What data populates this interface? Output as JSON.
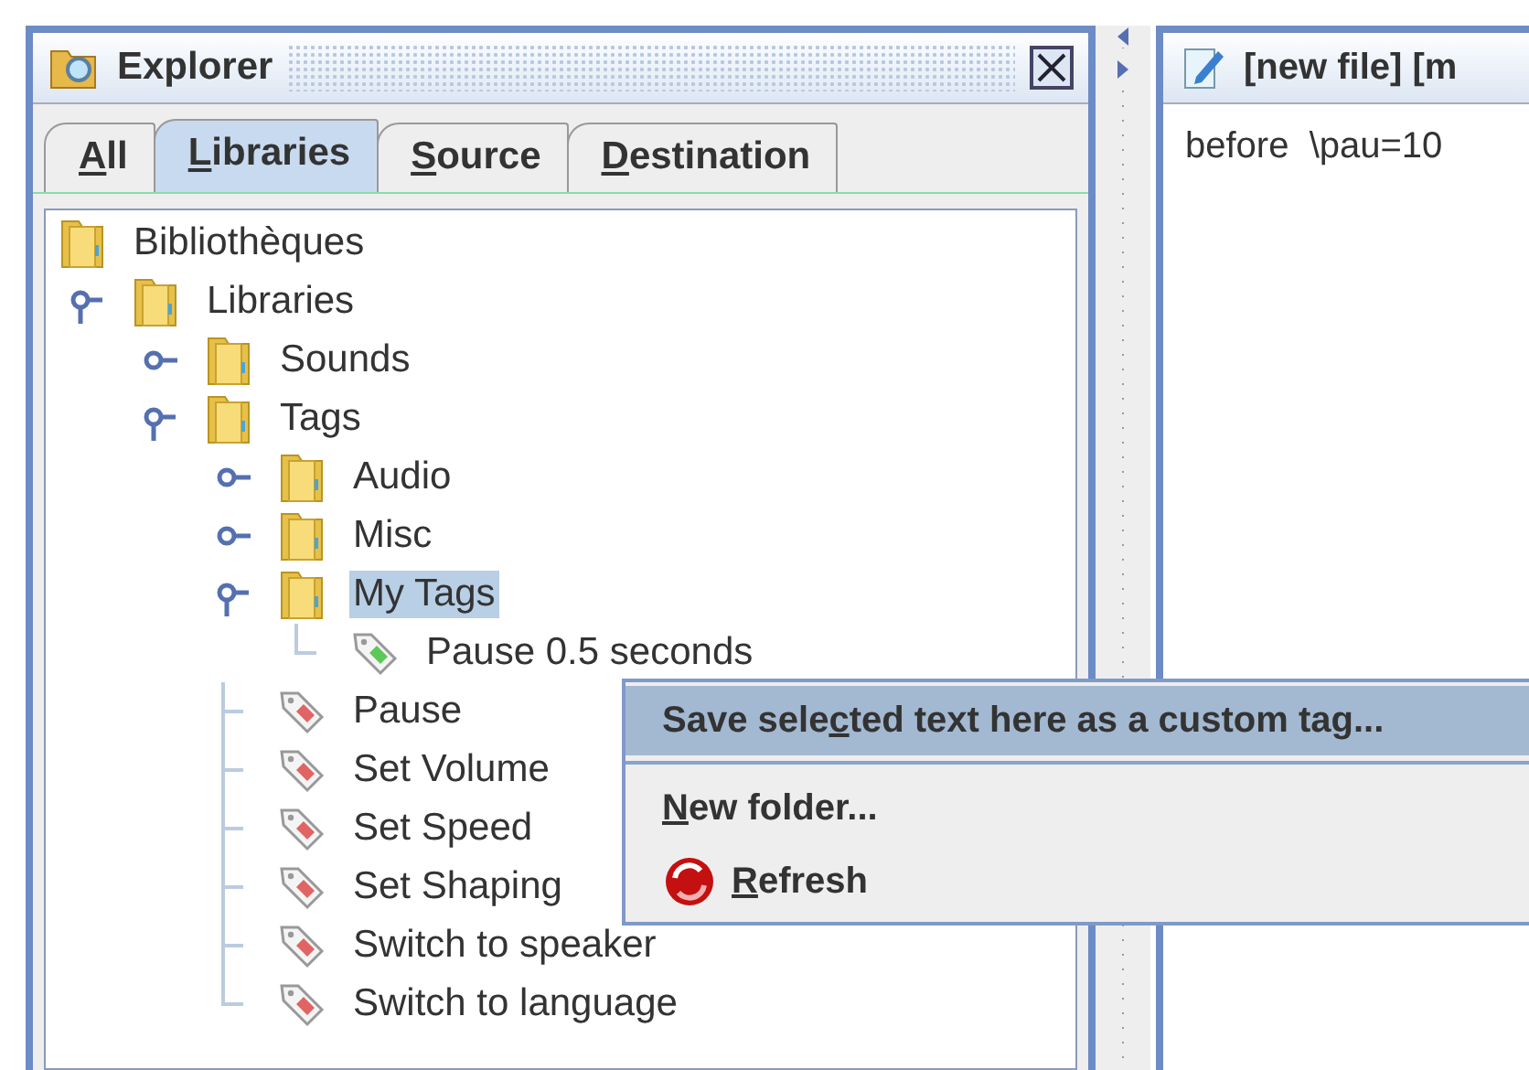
{
  "explorer": {
    "title": "Explorer",
    "tabs": [
      {
        "label_parts": {
          "key": "A",
          "after": "ll"
        },
        "selected": false
      },
      {
        "label_parts": {
          "key": "L",
          "after": "ibraries"
        },
        "selected": true
      },
      {
        "label_parts": {
          "key": "S",
          "after": "ource"
        },
        "selected": false
      },
      {
        "label_parts": {
          "key": "D",
          "after": "estination"
        },
        "selected": false
      }
    ],
    "tree": [
      {
        "kind": "folder",
        "label": "Bibliothèques",
        "selected": false,
        "children": [
          {
            "kind": "folder",
            "label": "Libraries",
            "expanded": true,
            "selected": false,
            "children": [
              {
                "kind": "folder",
                "label": "Sounds",
                "expanded": false,
                "selected": false
              },
              {
                "kind": "folder",
                "label": "Tags",
                "expanded": true,
                "selected": false,
                "children": [
                  {
                    "kind": "folder",
                    "label": "Audio",
                    "expanded": false,
                    "selected": false
                  },
                  {
                    "kind": "folder",
                    "label": "Misc",
                    "expanded": false,
                    "selected": false
                  },
                  {
                    "kind": "folder",
                    "label": "My Tags",
                    "expanded": true,
                    "selected": true,
                    "children": [
                      {
                        "kind": "tag",
                        "label": "Pause 0.5 seconds",
                        "color": "#5cc85c",
                        "selected": false
                      }
                    ]
                  },
                  {
                    "kind": "tag",
                    "label": "Pause",
                    "color": "#e06464",
                    "selected": false
                  },
                  {
                    "kind": "tag",
                    "label": "Set Volume",
                    "color": "#e06464",
                    "selected": false
                  },
                  {
                    "kind": "tag",
                    "label": "Set Speed",
                    "color": "#e06464",
                    "selected": false
                  },
                  {
                    "kind": "tag",
                    "label": "Set Shaping",
                    "color": "#e06464",
                    "selected": false
                  },
                  {
                    "kind": "tag",
                    "label": "Switch to speaker",
                    "color": "#e06464",
                    "selected": false
                  },
                  {
                    "kind": "tag",
                    "label": "Switch to language",
                    "color": "#e06464",
                    "selected": false
                  }
                ]
              }
            ]
          }
        ]
      }
    ]
  },
  "editor": {
    "title": "[new file] [m",
    "text": "before  \\pau=10"
  },
  "context_menu": {
    "items": [
      {
        "kind": "item",
        "label_parts": {
          "before": "Save sele",
          "key": "c",
          "after": "ted text here as a custom tag..."
        },
        "selected": true
      },
      {
        "kind": "separator"
      },
      {
        "kind": "item",
        "label_parts": {
          "key": "N",
          "after": "ew folder..."
        },
        "selected": false
      },
      {
        "kind": "refresh",
        "label_parts": {
          "key": "R",
          "after": "efresh"
        },
        "selected": false
      }
    ]
  }
}
